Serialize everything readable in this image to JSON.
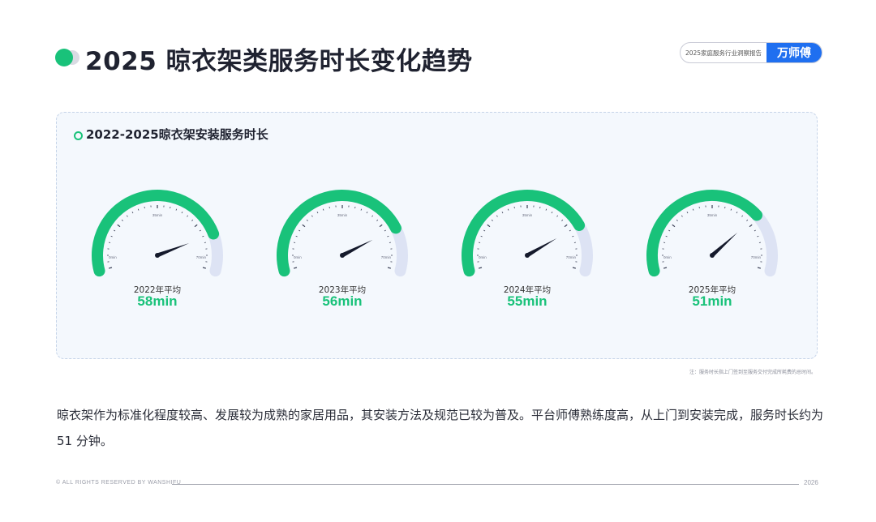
{
  "header": {
    "title": "2025 晾衣架类服务时长变化趋势",
    "brand_report": "2025家庭服务行业洞察报告",
    "brand_logo": "万师傅"
  },
  "colors": {
    "accent": "#19c27a",
    "track": "#dde3f4",
    "needle": "#151a2c",
    "brand": "#1f6ff0"
  },
  "chart_data": [
    {
      "type": "gauge",
      "title": "2022-2025晾衣架安装服务时长",
      "scale": {
        "min_label": "0min",
        "mid_label": "35min",
        "max_label": "70min",
        "min": 0,
        "max": 70
      },
      "gauges": [
        {
          "year_label": "2022年平均",
          "value": 58,
          "value_label": "58min"
        },
        {
          "year_label": "2023年平均",
          "value": 56,
          "value_label": "56min"
        },
        {
          "year_label": "2024年平均",
          "value": 55,
          "value_label": "55min"
        },
        {
          "year_label": "2025年平均",
          "value": 51,
          "value_label": "51min"
        }
      ]
    }
  ],
  "note": "注：服务时长指上门签到至服务交付完成所耗费的总时间。",
  "body_text": "晾衣架作为标准化程度较高、发展较为成熟的家居用品，其安装方法及规范已较为普及。平台师傅熟练度高，从上门到安装完成，服务时长约为 51 分钟。",
  "footer": {
    "copyright": "© ALL RIGHTS RESERVED BY WANSHIFU",
    "year": "2026"
  }
}
